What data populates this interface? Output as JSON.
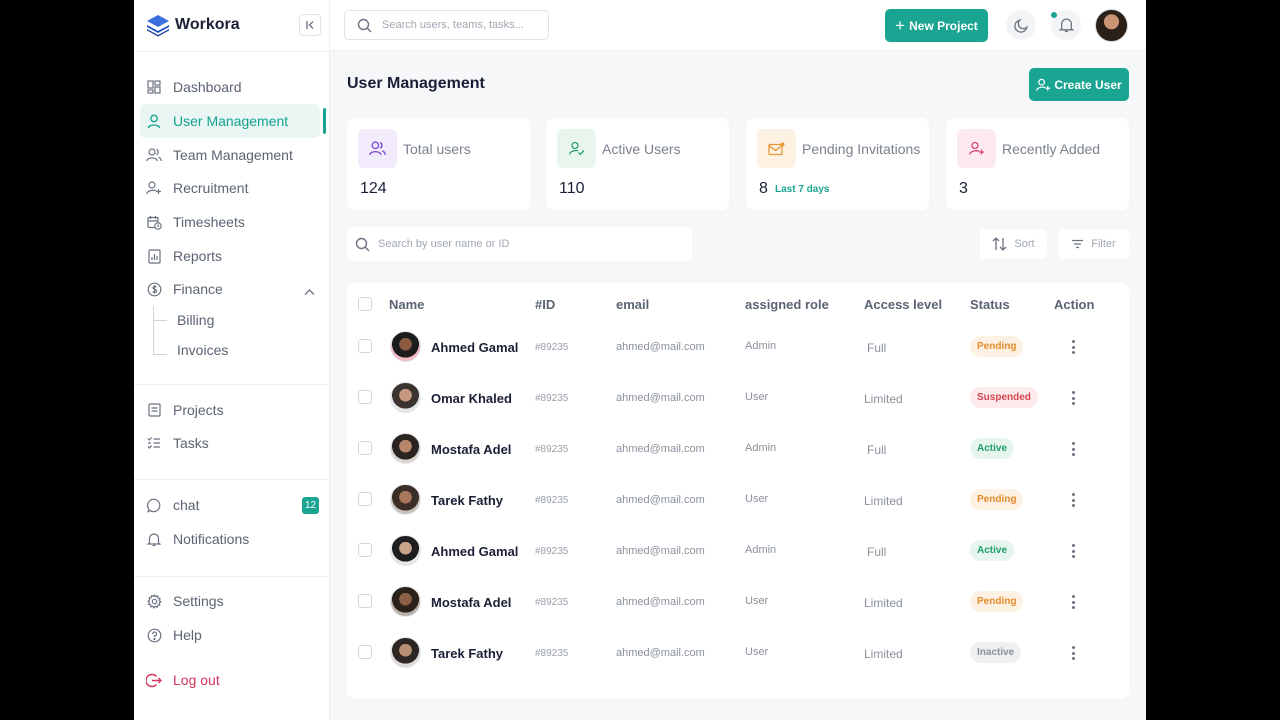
{
  "brand": {
    "name": "Workora"
  },
  "sidebar": {
    "items": [
      {
        "label": "Dashboard",
        "icon": "dashboard-icon"
      },
      {
        "label": "User Management",
        "icon": "user-icon",
        "active": true
      },
      {
        "label": "Team Management",
        "icon": "users-icon"
      },
      {
        "label": "Recruitment",
        "icon": "user-plus-icon"
      },
      {
        "label": "Timesheets",
        "icon": "calendar-clock-icon"
      },
      {
        "label": "Reports",
        "icon": "report-icon"
      },
      {
        "label": "Finance",
        "icon": "dollar-icon",
        "expanded": true
      }
    ],
    "finance_sub": [
      "Billing",
      "Invoices"
    ],
    "work": [
      {
        "label": "Projects",
        "icon": "projects-icon"
      },
      {
        "label": "Tasks",
        "icon": "tasks-icon"
      }
    ],
    "comm": [
      {
        "label": "chat",
        "icon": "chat-icon",
        "badge": "12"
      },
      {
        "label": "Notifications",
        "icon": "bell-icon"
      }
    ],
    "system": [
      {
        "label": "Settings",
        "icon": "gear-icon"
      },
      {
        "label": "Help",
        "icon": "help-icon"
      }
    ],
    "logout": "Log out"
  },
  "topbar": {
    "search_placeholder": "Search users, teams, tasks...",
    "new_project": "New Project"
  },
  "main": {
    "title": "User Management",
    "create_user": "Create User",
    "stats": [
      {
        "label": "Total users",
        "value": "124",
        "icon": "users-icon",
        "bg": "#f1ebfb",
        "fg": "#7c4dd6"
      },
      {
        "label": "Active Users",
        "value": "110",
        "icon": "user-check-icon",
        "bg": "#e8f6ee",
        "fg": "#2aa06b"
      },
      {
        "label": "Pending Invitations",
        "value": "8",
        "note": "Last 7 days",
        "icon": "mail-icon",
        "bg": "#fdf1e3",
        "fg": "#e59a33"
      },
      {
        "label": "Recently Added",
        "value": "3",
        "icon": "user-plus-icon",
        "bg": "#fdeaf0",
        "fg": "#d6456e"
      }
    ],
    "list_search_placeholder": "Search by user name or ID",
    "sort": "Sort",
    "filter": "Filter",
    "columns": [
      "Name",
      "#ID",
      "email",
      "assigned role",
      "Access level",
      "Status",
      "Action"
    ],
    "rows": [
      {
        "name": "Ahmed Gamal",
        "id": "#89235",
        "email": "ahmed@mail.com",
        "role": "Admin",
        "access": "Full",
        "status": "Pending"
      },
      {
        "name": "Omar Khaled",
        "id": "#89235",
        "email": "ahmed@mail.com",
        "role": "User",
        "access": "Limited",
        "status": "Suspended"
      },
      {
        "name": "Mostafa Adel",
        "id": "#89235",
        "email": "ahmed@mail.com",
        "role": "Admin",
        "access": "Full",
        "status": "Active"
      },
      {
        "name": "Tarek Fathy",
        "id": "#89235",
        "email": "ahmed@mail.com",
        "role": "User",
        "access": "Limited",
        "status": "Pending"
      },
      {
        "name": "Ahmed Gamal",
        "id": "#89235",
        "email": "ahmed@mail.com",
        "role": "Admin",
        "access": "Full",
        "status": "Active"
      },
      {
        "name": "Mostafa Adel",
        "id": "#89235",
        "email": "ahmed@mail.com",
        "role": "User",
        "access": "Limited",
        "status": "Pending"
      },
      {
        "name": "Tarek Fathy",
        "id": "#89235",
        "email": "ahmed@mail.com",
        "role": "User",
        "access": "Limited",
        "status": "Inactive"
      }
    ]
  },
  "colors": {
    "accent": "#1aa592",
    "logout": "#d6345a",
    "pending": "#e38b2a",
    "suspended": "#d64550",
    "active": "#1f9d6b",
    "inactive": "#8a919c"
  }
}
